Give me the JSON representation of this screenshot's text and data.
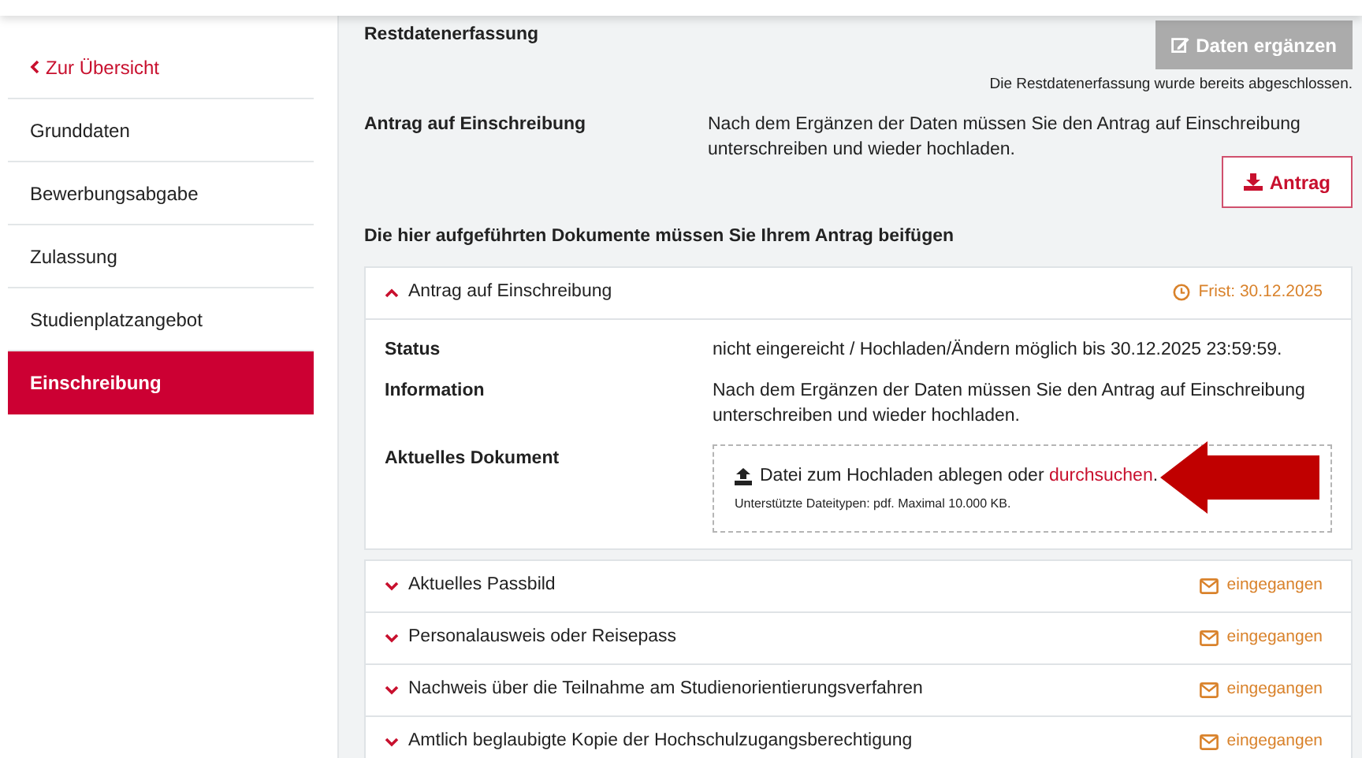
{
  "sidebar": {
    "back_link": "Zur Übersicht",
    "items": [
      {
        "label": "Grunddaten",
        "selected": false
      },
      {
        "label": "Bewerbungsabgabe",
        "selected": false
      },
      {
        "label": "Zulassung",
        "selected": false
      },
      {
        "label": "Studienplatzangebot",
        "selected": false
      },
      {
        "label": "Einschreibung",
        "selected": true
      }
    ]
  },
  "restdaten": {
    "title": "Restdatenerfassung",
    "button": "Daten ergänzen",
    "button_disabled": true,
    "note": "Die Restdatenerfassung wurde bereits abgeschlossen."
  },
  "antrag": {
    "title": "Antrag auf Einschreibung",
    "text": "Nach dem Ergänzen der Daten müssen Sie den Antrag auf Einschreibung unterschreiben und wieder hochladen.",
    "button": "Antrag"
  },
  "documents_heading": "Die hier aufgeführten Dokumente müssen Sie Ihrem Antrag beifügen",
  "documents": [
    {
      "title": "Antrag auf Einschreibung",
      "expanded": true,
      "kind": "deadline",
      "status": "Frist: 30.12.2025",
      "details": [
        {
          "label": "Status",
          "value": "nicht eingereicht / Hochladen/Ändern möglich bis 30.12.2025 23:59:59."
        },
        {
          "label": "Information",
          "value": "Nach dem Ergänzen der Daten müssen Sie den Antrag auf Einschreibung unterschreiben und wieder hochladen."
        }
      ],
      "upload": {
        "label": "Aktuelles Dokument",
        "text": "Datei zum Hochladen ablegen oder",
        "link": "durchsuchen",
        "after": ".",
        "hint": "Unterstützte Dateitypen: pdf. Maximal 10.000 KB."
      }
    },
    {
      "title": "Aktuelles Passbild",
      "expanded": false,
      "kind": "received",
      "status": "eingegangen"
    },
    {
      "title": "Personalausweis oder Reisepass",
      "expanded": false,
      "kind": "received",
      "status": "eingegangen"
    },
    {
      "title": "Nachweis über die Teilnahme am Studienorientierungsverfahren",
      "expanded": false,
      "kind": "received",
      "status": "eingegangen"
    },
    {
      "title": "Amtlich beglaubigte Kopie der Hochschulzugangsberechtigung",
      "expanded": false,
      "kind": "received",
      "status": "eingegangen"
    }
  ]
}
